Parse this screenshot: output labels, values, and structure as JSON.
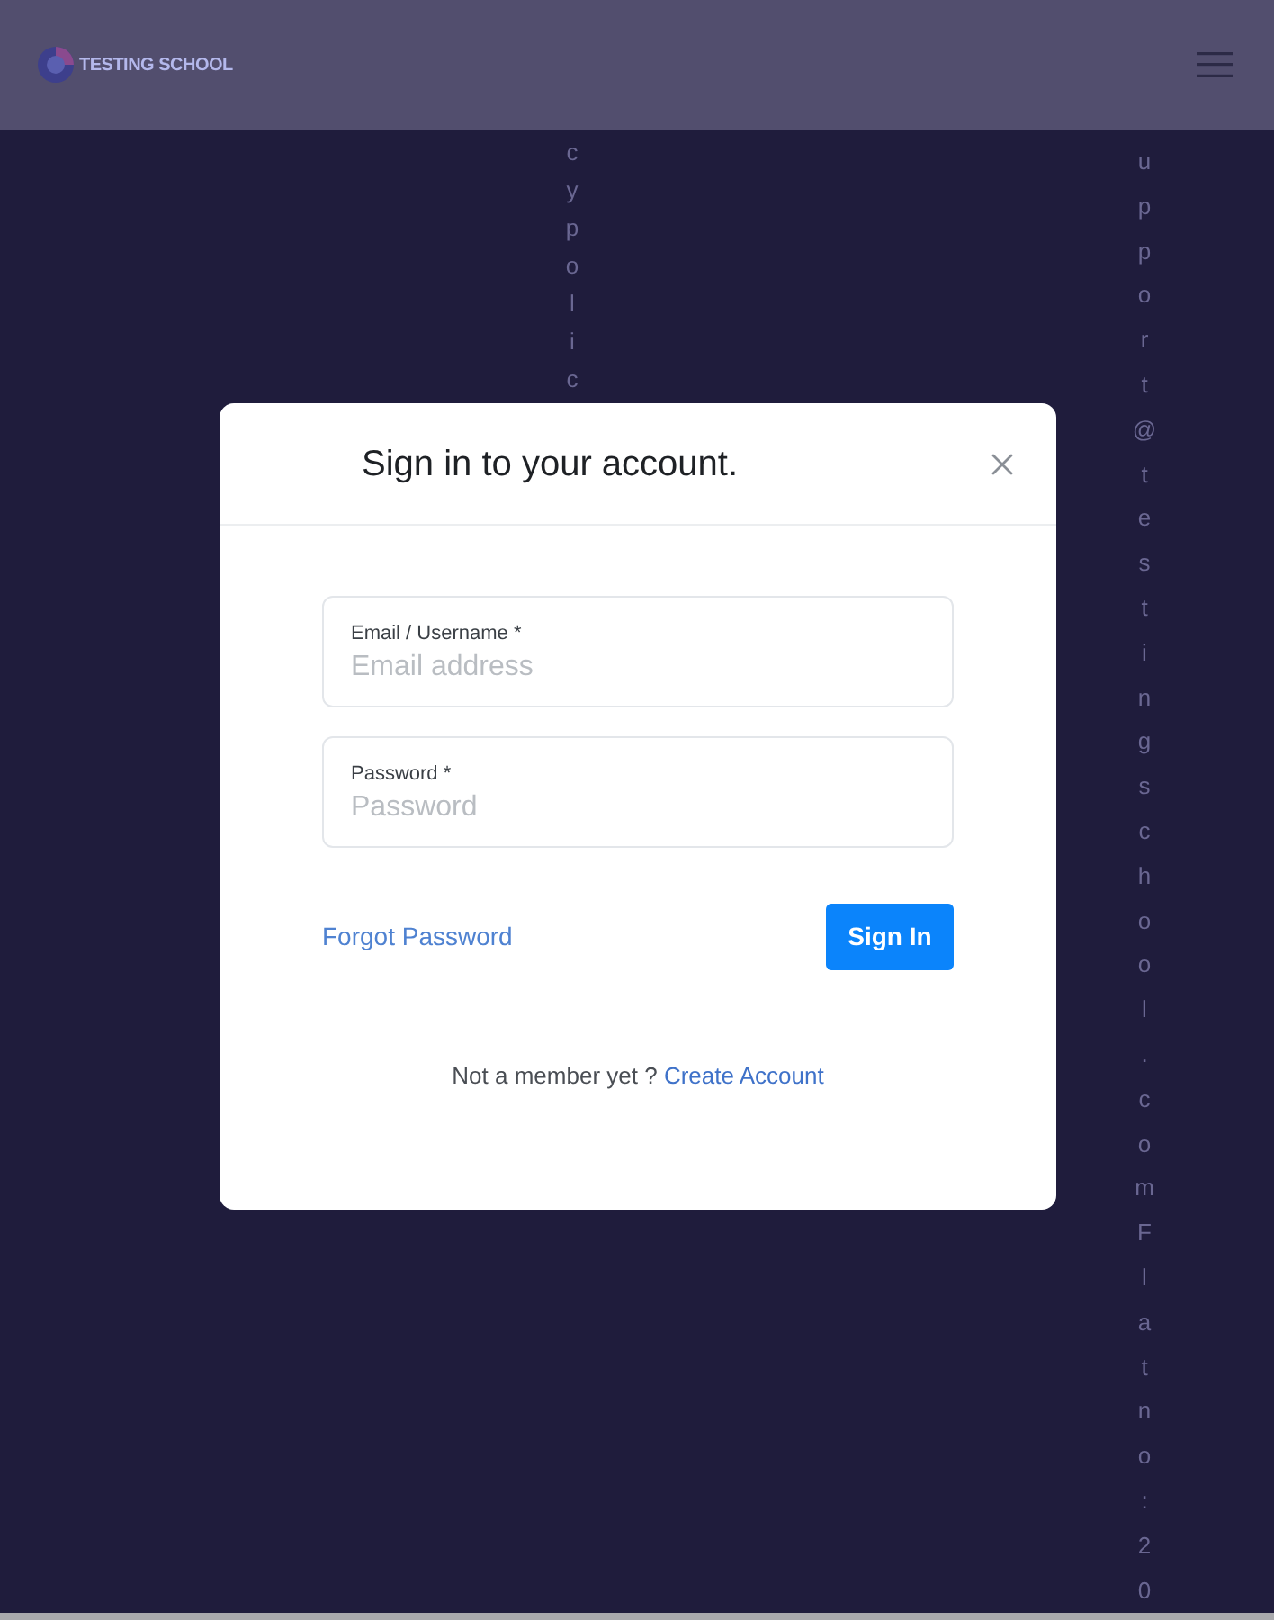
{
  "header": {
    "logo_text": "TESTING SCHOOL"
  },
  "background_columns": [
    {
      "text": "cypolic"
    },
    {
      "text": "upport@testingschool.comFlatno:20"
    }
  ],
  "dialog": {
    "title": "Sign in to your account.",
    "fields": [
      {
        "label": "Email / Username *",
        "placeholder": "Email address"
      },
      {
        "label": "Password *",
        "placeholder": "Password"
      }
    ],
    "forgot_link": "Forgot Password",
    "submit_button": "Sign In",
    "footer": {
      "text": "Not a member yet ?",
      "link": "Create Account"
    }
  }
}
